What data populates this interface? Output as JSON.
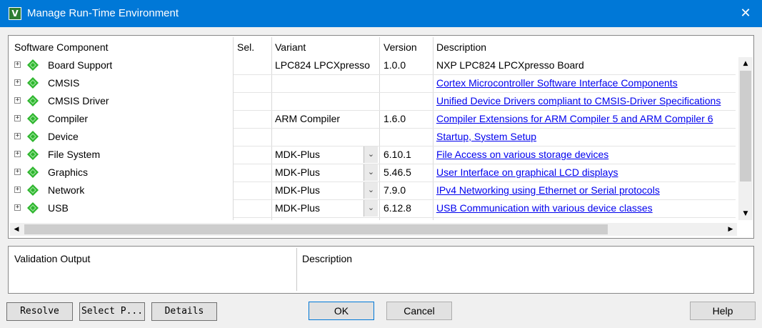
{
  "window": {
    "title": "Manage Run-Time Environment",
    "icon": "keil-v-icon",
    "close_glyph": "✕"
  },
  "grid": {
    "headers": {
      "component": "Software Component",
      "sel": "Sel.",
      "variant": "Variant",
      "version": "Version",
      "description": "Description"
    },
    "rows": [
      {
        "component": "Board Support",
        "variant": "LPC824 LPCXpresso",
        "version": "1.0.0",
        "description": "NXP LPC824 LPCXpresso Board",
        "is_link": false,
        "has_dropdown": false
      },
      {
        "component": "CMSIS",
        "variant": "",
        "version": "",
        "description": "Cortex Microcontroller Software Interface Components",
        "is_link": true,
        "has_dropdown": false
      },
      {
        "component": "CMSIS Driver",
        "variant": "",
        "version": "",
        "description": "Unified Device Drivers compliant to CMSIS-Driver Specifications",
        "is_link": true,
        "has_dropdown": false
      },
      {
        "component": "Compiler",
        "variant": "ARM Compiler",
        "version": "1.6.0",
        "description": "Compiler Extensions for ARM Compiler 5 and ARM Compiler 6",
        "is_link": true,
        "has_dropdown": false
      },
      {
        "component": "Device",
        "variant": "",
        "version": "",
        "description": "Startup, System Setup",
        "is_link": true,
        "has_dropdown": false
      },
      {
        "component": "File System",
        "variant": "MDK-Plus",
        "version": "6.10.1",
        "description": "File Access on various storage devices",
        "is_link": true,
        "has_dropdown": true
      },
      {
        "component": "Graphics",
        "variant": "MDK-Plus",
        "version": "5.46.5",
        "description": "User Interface on graphical LCD displays",
        "is_link": true,
        "has_dropdown": true
      },
      {
        "component": "Network",
        "variant": "MDK-Plus",
        "version": "7.9.0",
        "description": "IPv4 Networking using Ethernet or Serial protocols",
        "is_link": true,
        "has_dropdown": true
      },
      {
        "component": "USB",
        "variant": "MDK-Plus",
        "version": "6.12.8",
        "description": "USB Communication with various device classes",
        "is_link": true,
        "has_dropdown": true
      }
    ],
    "expander_glyph": "+",
    "dropdown_glyph": "⌄",
    "component_icon": "green-gem-icon",
    "scroll": {
      "up": "▲",
      "down": "▼",
      "left": "◀",
      "right": "▶"
    }
  },
  "validation": {
    "output_label": "Validation Output",
    "description_label": "Description"
  },
  "buttons": {
    "resolve": "Resolve",
    "select_packs": "Select P...",
    "details": "Details",
    "ok": "OK",
    "cancel": "Cancel",
    "help": "Help"
  },
  "colors": {
    "title_bar": "#0078d7",
    "link": "#0000ee",
    "gem": "#2db52d"
  }
}
